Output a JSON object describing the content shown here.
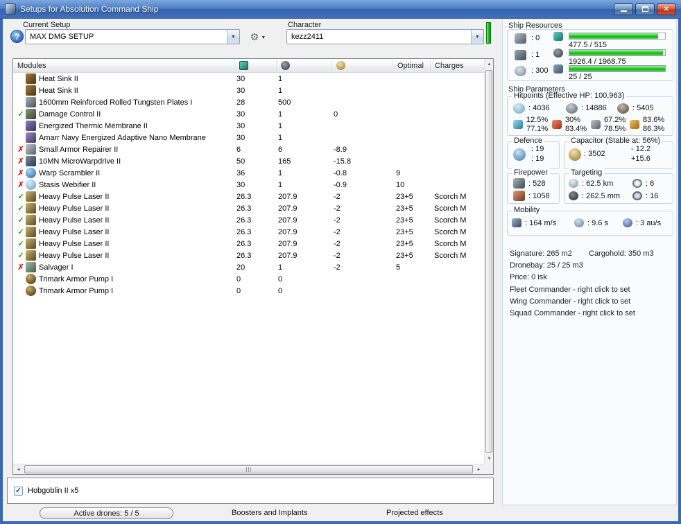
{
  "window": {
    "title": "Setups for Absolution Command Ship"
  },
  "toolbar": {
    "current_setup_label": "Current Setup",
    "setup_value": "MAX DMG SETUP",
    "character_label": "Character",
    "character_value": "kezz2411",
    "help_glyph": "?"
  },
  "modules": {
    "header": {
      "name": "Modules",
      "optimal": "Optimal",
      "charges": "Charges"
    },
    "rows": [
      {
        "status": "",
        "icon": "heat-sink",
        "name": "Heat Sink II",
        "cpu": "30",
        "pg": "1",
        "cap": "",
        "optimal": "",
        "charge": ""
      },
      {
        "status": "",
        "icon": "heat-sink",
        "name": "Heat Sink II",
        "cpu": "30",
        "pg": "1",
        "cap": "",
        "optimal": "",
        "charge": ""
      },
      {
        "status": "",
        "icon": "armor-plate",
        "name": "1600mm Reinforced Rolled Tungsten Plates I",
        "cpu": "28",
        "pg": "500",
        "cap": "",
        "optimal": "",
        "charge": ""
      },
      {
        "status": "ok",
        "icon": "damage-control",
        "name": "Damage Control II",
        "cpu": "30",
        "pg": "1",
        "cap": "0",
        "optimal": "",
        "charge": ""
      },
      {
        "status": "",
        "icon": "thermic-membrane",
        "name": "Energized Thermic Membrane II",
        "cpu": "30",
        "pg": "1",
        "cap": "",
        "optimal": "",
        "charge": ""
      },
      {
        "status": "",
        "icon": "adaptive-membrane",
        "name": "Amarr Navy Energized Adaptive Nano Membrane",
        "cpu": "30",
        "pg": "1",
        "cap": "",
        "optimal": "",
        "charge": ""
      },
      {
        "status": "off",
        "icon": "armor-repairer",
        "name": "Small Armor Repairer II",
        "cpu": "6",
        "pg": "6",
        "cap": "-8.9",
        "optimal": "",
        "charge": ""
      },
      {
        "status": "off",
        "icon": "microwarpdrive",
        "name": "10MN MicroWarpdrive II",
        "cpu": "50",
        "pg": "165",
        "cap": "-15.8",
        "optimal": "",
        "charge": ""
      },
      {
        "status": "off",
        "icon": "warp-scrambler",
        "name": "Warp Scrambler II",
        "cpu": "36",
        "pg": "1",
        "cap": "-0.8",
        "optimal": "9",
        "charge": ""
      },
      {
        "status": "off",
        "icon": "stasis-webifier",
        "name": "Stasis Webifier II",
        "cpu": "30",
        "pg": "1",
        "cap": "-0.9",
        "optimal": "10",
        "charge": ""
      },
      {
        "status": "ok",
        "icon": "pulse-laser",
        "name": "Heavy Pulse Laser II",
        "cpu": "26.3",
        "pg": "207.9",
        "cap": "-2",
        "optimal": "23+5",
        "charge": "Scorch M"
      },
      {
        "status": "ok",
        "icon": "pulse-laser",
        "name": "Heavy Pulse Laser II",
        "cpu": "26.3",
        "pg": "207.9",
        "cap": "-2",
        "optimal": "23+5",
        "charge": "Scorch M"
      },
      {
        "status": "ok",
        "icon": "pulse-laser",
        "name": "Heavy Pulse Laser II",
        "cpu": "26.3",
        "pg": "207.9",
        "cap": "-2",
        "optimal": "23+5",
        "charge": "Scorch M"
      },
      {
        "status": "ok",
        "icon": "pulse-laser",
        "name": "Heavy Pulse Laser II",
        "cpu": "26.3",
        "pg": "207.9",
        "cap": "-2",
        "optimal": "23+5",
        "charge": "Scorch M"
      },
      {
        "status": "ok",
        "icon": "pulse-laser",
        "name": "Heavy Pulse Laser II",
        "cpu": "26.3",
        "pg": "207.9",
        "cap": "-2",
        "optimal": "23+5",
        "charge": "Scorch M"
      },
      {
        "status": "ok",
        "icon": "pulse-laser",
        "name": "Heavy Pulse Laser II",
        "cpu": "26.3",
        "pg": "207.9",
        "cap": "-2",
        "optimal": "23+5",
        "charge": "Scorch M"
      },
      {
        "status": "off",
        "icon": "salvager",
        "name": "Salvager I",
        "cpu": "20",
        "pg": "1",
        "cap": "-2",
        "optimal": "5",
        "charge": ""
      },
      {
        "status": "",
        "icon": "armor-rig",
        "name": "Trimark Armor Pump I",
        "cpu": "0",
        "pg": "0",
        "cap": "",
        "optimal": "",
        "charge": ""
      },
      {
        "status": "",
        "icon": "armor-rig",
        "name": "Trimark Armor Pump I",
        "cpu": "0",
        "pg": "0",
        "cap": "",
        "optimal": "",
        "charge": ""
      }
    ]
  },
  "ship_resources": {
    "title": "Ship Resources",
    "turrets": ": 0",
    "launchers": ": 1",
    "calibration": ": 300",
    "cpu": {
      "text": "477.5 / 515",
      "pct": 92.7
    },
    "powergrid": {
      "text": "1926.4 / 1968.75",
      "pct": 97.8
    },
    "dronebay": {
      "text": "25 / 25",
      "pct": 100
    }
  },
  "ship_parameters": {
    "title": "Ship Parameters",
    "hitpoints": {
      "title": "Hitpoints (Effective HP: 100,963)",
      "shield": ": 4036",
      "armor": ": 14886",
      "hull": ": 5405",
      "resists": [
        {
          "top": "12.5%",
          "bottom": "77.1%"
        },
        {
          "top": "30%",
          "bottom": "83.4%"
        },
        {
          "top": "67.2%",
          "bottom": "78.5%"
        },
        {
          "top": "83.6%",
          "bottom": "86.3%"
        }
      ]
    },
    "defence": {
      "title": "Defence",
      "value1": ": 19",
      "value2": ": 19"
    },
    "capacitor": {
      "title": "Capacitor (Stable at: 56%)",
      "amount": ": 3502",
      "usage": "- 12.2",
      "recharge": "+15.6"
    },
    "firepower": {
      "title": "Firepower",
      "dps": ": 528",
      "volley": ": 1058"
    },
    "targeting": {
      "title": "Targeting",
      "range": ": 62.5 km",
      "max_targets": ": 6",
      "scan_resolution": ": 262.5 mm",
      "sensor_strength": ": 16"
    },
    "mobility": {
      "title": "Mobility",
      "speed": ": 164 m/s",
      "agility": ": 9.6 s",
      "warp_speed": ": 3 au/s"
    },
    "signature": "Signature: 265 m2",
    "cargohold": "Cargohold: 350 m3",
    "dronebay": "Dronebay: 25 / 25 m3",
    "price": "Price: 0 isk",
    "fleet_commander": "Fleet Commander - right click to set",
    "wing_commander": "Wing Commander - right click to set",
    "squad_commander": "Squad Commander - right click to set"
  },
  "drones_panel": {
    "items": [
      {
        "label": "Hobgoblin II x5",
        "checked": true
      }
    ]
  },
  "bottom_bar": {
    "active_drones": "Active drones: 5 / 5",
    "boosters_and_implants": "Boosters and Implants",
    "projected_effects": "Projected effects"
  },
  "colors": {
    "accent_green": "#1db31d",
    "status_ok": "#21a31e",
    "status_off": "#dd2012",
    "titlebar_blue": "#3a69b4"
  }
}
